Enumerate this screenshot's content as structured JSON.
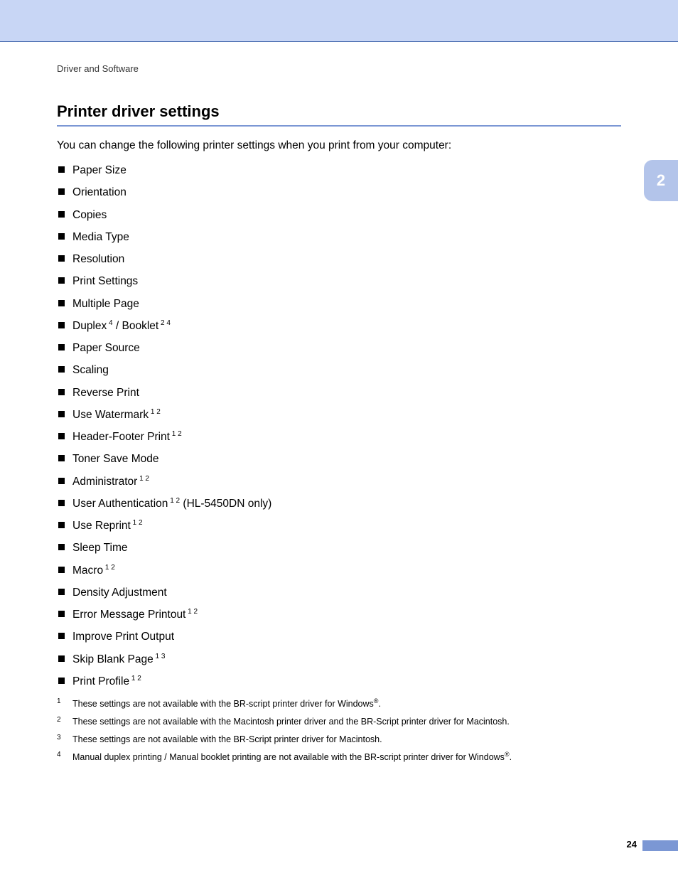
{
  "breadcrumb": "Driver and Software",
  "heading": "Printer driver settings",
  "intro": "You can change the following printer settings when you print from your computer:",
  "chapter": "2",
  "page_number": "24",
  "settings": [
    {
      "text": "Paper Size",
      "sup": ""
    },
    {
      "text": "Orientation",
      "sup": ""
    },
    {
      "text": "Copies",
      "sup": ""
    },
    {
      "text": "Media Type",
      "sup": ""
    },
    {
      "text": "Resolution",
      "sup": ""
    },
    {
      "text": "Print Settings",
      "sup": ""
    },
    {
      "text": "Multiple Page",
      "sup": ""
    },
    {
      "text_a": "Duplex",
      "sup_a": " 4",
      "text_b": " / Booklet",
      "sup_b": " 2 4"
    },
    {
      "text": "Paper Source",
      "sup": ""
    },
    {
      "text": "Scaling",
      "sup": ""
    },
    {
      "text": "Reverse Print",
      "sup": ""
    },
    {
      "text": "Use Watermark",
      "sup": " 1 2"
    },
    {
      "text": "Header-Footer Print",
      "sup": " 1 2"
    },
    {
      "text": "Toner Save Mode",
      "sup": ""
    },
    {
      "text": "Administrator",
      "sup": " 1 2"
    },
    {
      "text": "User Authentication",
      "sup": " 1 2",
      "suffix": " (HL-5450DN only)"
    },
    {
      "text": "Use Reprint",
      "sup": " 1 2"
    },
    {
      "text": "Sleep Time",
      "sup": ""
    },
    {
      "text": "Macro",
      "sup": " 1 2"
    },
    {
      "text": "Density Adjustment",
      "sup": ""
    },
    {
      "text": "Error Message Printout",
      "sup": " 1 2"
    },
    {
      "text": "Improve Print Output",
      "sup": ""
    },
    {
      "text": "Skip Blank Page",
      "sup": " 1 3"
    },
    {
      "text": "Print Profile",
      "sup": " 1 2"
    }
  ],
  "footnotes": [
    {
      "num": "1",
      "text_a": "These settings are not available with the BR-script printer driver for Windows",
      "reg": "®",
      "text_b": "."
    },
    {
      "num": "2",
      "text_a": "These settings are not available with the Macintosh printer driver and the BR-Script printer driver for Macintosh.",
      "reg": "",
      "text_b": ""
    },
    {
      "num": "3",
      "text_a": "These settings are not available with the BR-Script printer driver for Macintosh.",
      "reg": "",
      "text_b": ""
    },
    {
      "num": "4",
      "text_a": "Manual duplex printing / Manual booklet printing are not available with the BR-script printer driver for Windows",
      "reg": "®",
      "text_b": "."
    }
  ]
}
